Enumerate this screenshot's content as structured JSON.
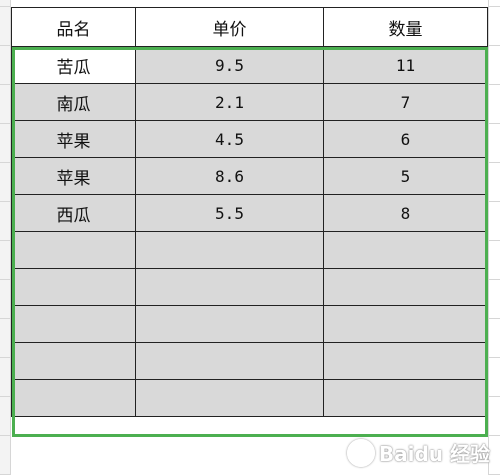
{
  "table": {
    "headers": [
      "品名",
      "单价",
      "数量"
    ],
    "rows": [
      {
        "name": "苦瓜",
        "price": "9.5",
        "qty": "11"
      },
      {
        "name": "南瓜",
        "price": "2.1",
        "qty": "7"
      },
      {
        "name": "苹果",
        "price": "4.5",
        "qty": "6"
      },
      {
        "name": "苹果",
        "price": "8.6",
        "qty": "5"
      },
      {
        "name": "西瓜",
        "price": "5.5",
        "qty": "8"
      },
      {
        "name": "",
        "price": "",
        "qty": ""
      },
      {
        "name": "",
        "price": "",
        "qty": ""
      },
      {
        "name": "",
        "price": "",
        "qty": ""
      },
      {
        "name": "",
        "price": "",
        "qty": ""
      },
      {
        "name": "",
        "price": "",
        "qty": ""
      }
    ]
  },
  "watermark": {
    "text": "Baidu 经验"
  },
  "colors": {
    "selection_border": "#4caf50",
    "selected_fill": "#d9d9d9",
    "grid_line": "#222222"
  }
}
